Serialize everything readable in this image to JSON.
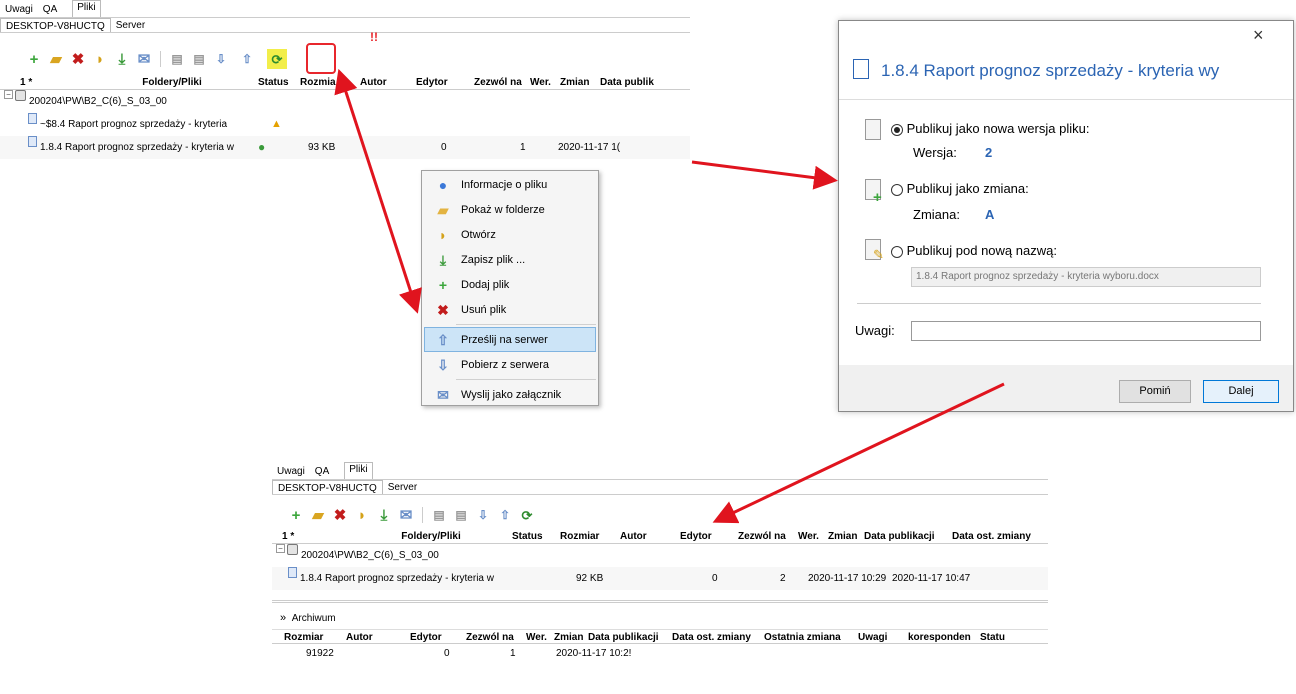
{
  "panel": {
    "tabs": [
      "Uwagi",
      "QA",
      "Pliki"
    ],
    "subtabs": [
      "DESKTOP-V8HUCTQ",
      "Server"
    ],
    "columns": {
      "num": "1 *",
      "name": "Foldery/Pliki",
      "status": "Status",
      "size": "Rozmiar",
      "author": "Autor",
      "editor": "Edytor",
      "permit": "Zezwól na",
      "ver": "Wer.",
      "change": "Zmian",
      "pubdate": "Data publikacji",
      "moddate": "Data ost. zmiany"
    },
    "folder": "200204\\PW\\B2_C(6)_S_03_00"
  },
  "top_table": {
    "col_size": "Rozmia",
    "col_pubdate": "Data publik",
    "file_temp": "~$8.4 Raport prognoz sprzedaży - kryteria",
    "file_main": "1.8.4 Raport prognoz sprzedaży - kryteria w",
    "file_main_size": "93 KB",
    "file_main_permit": "0",
    "file_main_ver": "1",
    "file_main_pubdate": "2020-11-17 1("
  },
  "annotation": "!!",
  "context_menu": {
    "items": [
      {
        "icon": "info-icon",
        "label": "Informacje o pliku"
      },
      {
        "icon": "folder-icon",
        "label": "Pokaż w folderze"
      },
      {
        "icon": "open-icon",
        "label": "Otwórz"
      },
      {
        "icon": "save-icon",
        "label": "Zapisz plik ..."
      },
      {
        "icon": "add-icon",
        "label": "Dodaj plik"
      },
      {
        "icon": "delete-icon",
        "label": "Usuń plik"
      },
      {
        "icon": "upload-icon",
        "label": "Prześlij na serwer"
      },
      {
        "icon": "download-icon",
        "label": "Pobierz z serwera"
      },
      {
        "icon": "mail-icon",
        "label": "Wyslij jako załącznik"
      }
    ],
    "selected": "Prześlij na serwer"
  },
  "dialog": {
    "title": "1.8.4 Raport prognoz sprzedaży - kryteria wy",
    "close": "×",
    "option_version_label": "Publikuj jako nowa wersja pliku:",
    "version_label": "Wersja:",
    "version_value": "2",
    "option_change_label": "Publikuj jako zmiana:",
    "change_label": "Zmiana:",
    "change_value": "A",
    "option_rename_label": "Publikuj pod nową nazwą:",
    "rename_value": "1.8.4 Raport prognoz sprzedaży - kryteria wyboru.docx",
    "notes_label": "Uwagi:",
    "notes_value": "",
    "skip_button": "Pomiń",
    "next_button": "Dalej"
  },
  "bottom_table": {
    "file_main": "1.8.4 Raport prognoz sprzedaży - kryteria w",
    "size": "92 KB",
    "permit": "0",
    "ver": "2",
    "pubdate": "2020-11-17 10:29",
    "moddate": "2020-11-17 10:47"
  },
  "archive": {
    "label": "Archiwum",
    "columns": [
      "Rozmiar",
      "Autor",
      "Edytor",
      "Zezwól na",
      "Wer.",
      "Zmian",
      "Data publikacji",
      "Data ost. zmiany",
      "Ostatnia zmiana",
      "Uwagi",
      "koresponden",
      "Statu"
    ],
    "row": {
      "size": "91922",
      "permit": "0",
      "ver": "1",
      "pubdate": "2020-11-17 10:2!"
    }
  },
  "colors": {
    "arrow": "#e0141e",
    "highlight": "#e8262c",
    "selection": "#cce4f7",
    "accent": "#2b64b3"
  }
}
